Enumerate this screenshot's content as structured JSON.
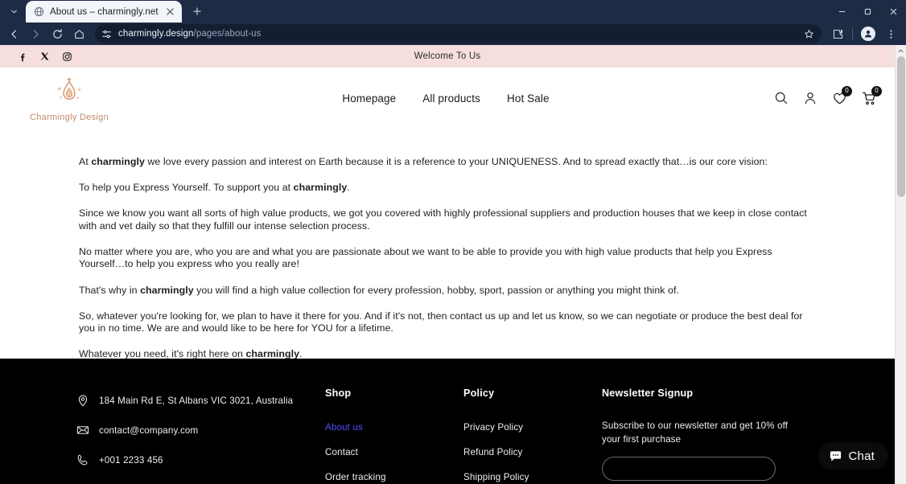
{
  "browser": {
    "tab": {
      "title": "About us – charmingly.net",
      "favicon_name": "globe-favicon",
      "close_label": "×"
    },
    "newtab_label": "+",
    "window": {
      "minimize": "–",
      "maximize": "□",
      "close": "×"
    },
    "toolbar": {
      "back": "back-arrow-icon",
      "forward": "forward-arrow-icon",
      "reload": "reload-icon",
      "home": "home-icon"
    },
    "omnibox": {
      "site_icon": "page-settings-icon",
      "url_domain": "charmingly.design",
      "url_path": "/pages/about-us",
      "bookmark": "star-icon"
    },
    "extensions_icon": "extensions-puzzle-icon",
    "profile_icon": "profile-avatar-icon",
    "menu_icon": "three-dot-menu-icon"
  },
  "announce": {
    "text": "Welcome To Us",
    "socials": [
      {
        "name": "facebook-icon",
        "label": "f"
      },
      {
        "name": "x-twitter-icon",
        "label": "X"
      },
      {
        "name": "instagram-icon",
        "label": "ig"
      }
    ]
  },
  "header": {
    "logo_text": "Charmingly Design",
    "logo_color": "#d99b73",
    "nav": [
      {
        "label": "Homepage"
      },
      {
        "label": "All products"
      },
      {
        "label": "Hot Sale"
      }
    ],
    "icons": {
      "search": "search-icon",
      "account": "account-icon",
      "wishlist": "heart-icon",
      "wishlist_count": "0",
      "cart": "cart-icon",
      "cart_count": "0"
    }
  },
  "content": {
    "paragraphs": [
      {
        "pre": "At ",
        "bold": "charmingly",
        "post": " we love every passion and interest on Earth because it is a reference to your UNIQUENESS. And to spread exactly that…is our core vision:"
      },
      {
        "pre": "To help you Express Yourself. To support you at ",
        "bold": "charmingly",
        "post": "."
      },
      {
        "pre": "Since we know you want all sorts of high value products, we got you covered with highly professional suppliers and production houses that we keep in close contact with and vet daily so that they fulfill our intense selection process.",
        "bold": "",
        "post": ""
      },
      {
        "pre": "No matter where you are, who you are and what you are passionate about we want to be able to provide you with high value products that help you Express Yourself…to help you express who you really are!",
        "bold": "",
        "post": ""
      },
      {
        "pre": "That's why in ",
        "bold": "charmingly",
        "post": " you will find a high value collection for every profession, hobby, sport, passion or anything you might think of."
      },
      {
        "pre": "So, whatever you're looking for, we plan to have it there for you. And if it's not, then contact us up and let us know, so we can negotiate or produce the best deal for you in no time. We are and would like to be here for YOU for a lifetime.",
        "bold": "",
        "post": ""
      },
      {
        "pre": "Whatever you need, it's right here on ",
        "bold": "charmingly",
        "post": "."
      }
    ]
  },
  "footer": {
    "contact": [
      {
        "icon": "location-pin-icon",
        "text": "184 Main Rd E, St Albans VIC 3021, Australia"
      },
      {
        "icon": "envelope-icon",
        "text": "contact@company.com"
      },
      {
        "icon": "phone-icon",
        "text": "+001 2233 456"
      }
    ],
    "shop": {
      "title": "Shop",
      "links": [
        {
          "label": "About us",
          "visited": true
        },
        {
          "label": "Contact",
          "visited": false
        },
        {
          "label": "Order tracking",
          "visited": false
        }
      ]
    },
    "policy": {
      "title": "Policy",
      "links": [
        {
          "label": "Privacy Policy",
          "visited": false
        },
        {
          "label": "Refund Policy",
          "visited": false
        },
        {
          "label": "Shipping Policy",
          "visited": false
        }
      ]
    },
    "newsletter": {
      "title": "Newsletter Signup",
      "description": "Subscribe to our newsletter and get 10% off your first purchase",
      "placeholder": ""
    }
  },
  "chat": {
    "label": "Chat",
    "icon": "chat-bubble-icon"
  }
}
